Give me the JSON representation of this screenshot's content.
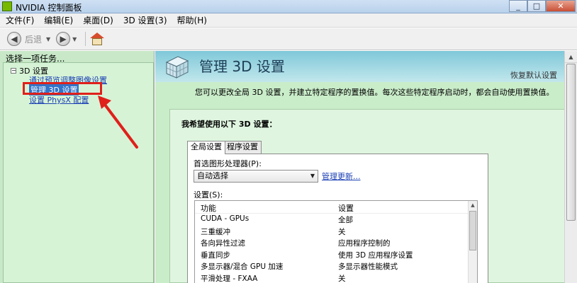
{
  "window": {
    "title": "NVIDIA 控制面板",
    "minimize": "_",
    "maximize": "□",
    "close": "✕"
  },
  "menubar": {
    "items": [
      "文件(F)",
      "编辑(E)",
      "桌面(D)",
      "3D 设置(3)",
      "帮助(H)"
    ]
  },
  "toolbar": {
    "back_label": "后退",
    "back_icon": "back-arrow-icon",
    "forward_icon": "forward-arrow-icon",
    "home_icon": "home-icon"
  },
  "left_pane": {
    "title": "选择一项任务...",
    "tree": {
      "root": "3D 设置",
      "toggle": "−",
      "children": [
        {
          "label": "通过预览调整图像设置",
          "selected": false
        },
        {
          "label": "管理 3D 设置",
          "selected": true
        },
        {
          "label": "设置 PhysX 配置",
          "selected": false
        }
      ]
    }
  },
  "annotation": {
    "color": "#e0201a"
  },
  "main": {
    "title": "管理 3D 设置",
    "restore_link": "恢复默认设置",
    "description": "您可以更改全局 3D 设置，并建立特定程序的置换值。每次这些特定程序启动时，都会自动使用置换值。",
    "group_title": "我希望使用以下 3D 设置：",
    "tabs": [
      {
        "label": "全局设置",
        "active": true
      },
      {
        "label": "程序设置",
        "active": false
      }
    ],
    "preferred_label": "首选图形处理器(P):",
    "preferred_value": "自动选择",
    "manage_link": "管理更新...",
    "settings_label": "设置(S):",
    "columns": {
      "feature": "功能",
      "setting": "设置"
    },
    "rows": [
      {
        "feature": "CUDA - GPUs",
        "setting": "全部"
      },
      {
        "feature": "三重缓冲",
        "setting": "关"
      },
      {
        "feature": "各向异性过滤",
        "setting": "应用程序控制的"
      },
      {
        "feature": "垂直同步",
        "setting": "使用 3D 应用程序设置"
      },
      {
        "feature": "多显示器/混合 GPU 加速",
        "setting": "多显示器性能模式"
      },
      {
        "feature": "平滑处理 - FXAA",
        "setting": "关"
      }
    ]
  },
  "colors": {
    "pane_green": "#c9ecc9",
    "header_teal": "#7fc8d9",
    "selection_blue": "#3374c8",
    "link_blue": "#1a3fb4"
  }
}
